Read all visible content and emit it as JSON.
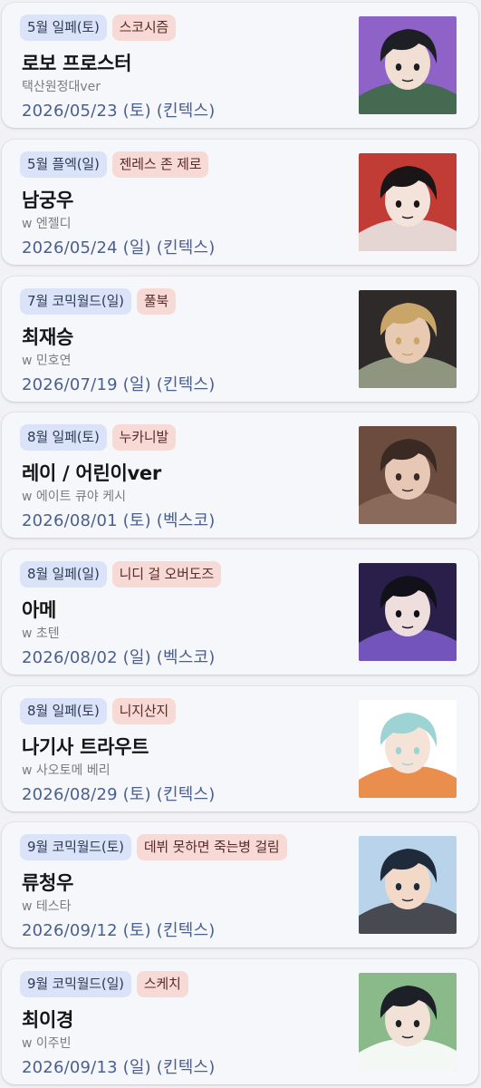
{
  "cards": [
    {
      "event": "5월 일페(토)",
      "series": "스코시즘",
      "name": "로보 프로스터",
      "sub": "택산원정대ver",
      "date": "2026/05/23 (토) (킨텍스)",
      "thumb": {
        "bg": "#8f62c8",
        "accent": "#1c1f24",
        "skin": "#f1dfd4",
        "detail": "#3c6b45"
      }
    },
    {
      "event": "5월 플엑(일)",
      "series": "젠레스 존 제로",
      "name": "남궁우",
      "sub": "w 엔젤디",
      "date": "2026/05/24 (일) (킨텍스)",
      "thumb": {
        "bg": "#c23c36",
        "accent": "#1a1516",
        "skin": "#f4e3da",
        "detail": "#e9e6e4"
      }
    },
    {
      "event": "7월 코믹월드(일)",
      "series": "풀북",
      "name": "최재승",
      "sub": "w 민호연",
      "date": "2026/07/19 (일) (킨텍스)",
      "thumb": {
        "bg": "#2d2a29",
        "accent": "#c9a56a",
        "skin": "#e8c9b2",
        "detail": "#9aa288"
      }
    },
    {
      "event": "8월 일페(토)",
      "series": "누카니발",
      "name": "레이 / 어린이ver",
      "sub": "w 에이트 큐야 케시",
      "date": "2026/08/01 (토) (벡스코)",
      "thumb": {
        "bg": "#6b4c3e",
        "accent": "#3b2a24",
        "skin": "#e7c8b6",
        "detail": "#8e6e5e"
      }
    },
    {
      "event": "8월 일페(일)",
      "series": "니디 걸 오버도즈",
      "name": "아메",
      "sub": "w 초텐",
      "date": "2026/08/02 (일) (벡스코)",
      "thumb": {
        "bg": "#2a1f4a",
        "accent": "#121019",
        "skin": "#efdede",
        "detail": "#7b5ac8"
      }
    },
    {
      "event": "8월 일페(토)",
      "series": "니지산지",
      "name": "나기사 트라우트",
      "sub": "w 사오토메 베리",
      "date": "2026/08/29 (토) (킨텍스)",
      "thumb": {
        "bg": "#ffffff",
        "accent": "#9ed3d4",
        "skin": "#f6e3d8",
        "detail": "#e8823a"
      }
    },
    {
      "event": "9월 코믹월드(토)",
      "series": "데뷔 못하면 죽는병 걸림",
      "name": "류청우",
      "sub": "w 테스타",
      "date": "2026/09/12 (토) (킨텍스)",
      "thumb": {
        "bg": "#b9d4ea",
        "accent": "#1f2a3a",
        "skin": "#f2d9c8",
        "detail": "#3b3b3f"
      }
    },
    {
      "event": "9월 코믹월드(일)",
      "series": "스케치",
      "name": "최이경",
      "sub": "w 이주빈",
      "date": "2026/09/13 (일) (킨텍스)",
      "thumb": {
        "bg": "#8ab98a",
        "accent": "#1d2026",
        "skin": "#f1e1d6",
        "detail": "#ffffff"
      }
    }
  ]
}
